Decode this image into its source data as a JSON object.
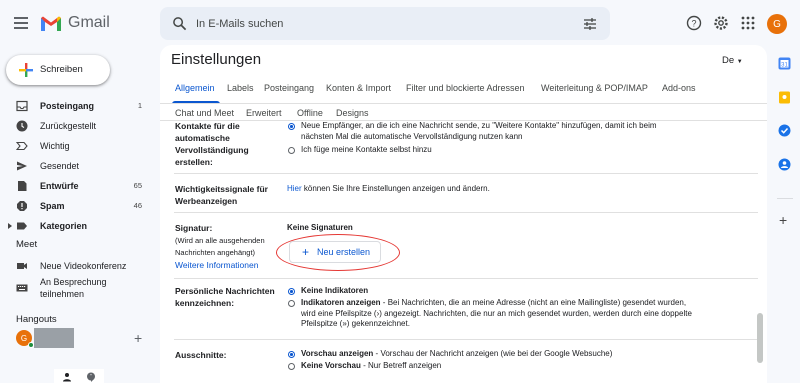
{
  "app": {
    "name": "Gmail"
  },
  "search": {
    "placeholder": "In E-Mails suchen"
  },
  "header": {
    "avatar_letter": "G"
  },
  "compose": {
    "label": "Schreiben"
  },
  "nav": {
    "items": [
      {
        "label": "Posteingang",
        "count": "1",
        "icon": "inbox-icon"
      },
      {
        "label": "Zurückgestellt",
        "count": "",
        "icon": "clock-icon"
      },
      {
        "label": "Wichtig",
        "count": "",
        "icon": "label-important-icon"
      },
      {
        "label": "Gesendet",
        "count": "",
        "icon": "send-icon"
      },
      {
        "label": "Entwürfe",
        "count": "65",
        "icon": "draft-icon"
      },
      {
        "label": "Spam",
        "count": "46",
        "icon": "spam-icon"
      },
      {
        "label": "Kategorien",
        "count": "",
        "icon": "label-icon"
      }
    ]
  },
  "meet": {
    "title": "Meet",
    "new_meeting": "Neue Videokonferenz",
    "join_line1": "An Besprechung",
    "join_line2": "teilnehmen"
  },
  "hangouts": {
    "title": "Hangouts",
    "avatar_letter": "G"
  },
  "settings": {
    "title": "Einstellungen",
    "lang": "De",
    "tabs": [
      "Allgemein",
      "Labels",
      "Posteingang",
      "Konten & Import",
      "Filter und blockierte Adressen",
      "Weiterleitung & POP/IMAP",
      "Add-ons",
      "Chat und Meet",
      "Erweitert",
      "Offline",
      "Designs"
    ]
  },
  "autocomplete": {
    "label1": "Kontakte für die",
    "label2": "automatische",
    "label3": "Vervollständigung",
    "label4": "erstellen:",
    "opt1_line1": "Neue Empfänger, an die ich eine Nachricht sende, zu \"Weitere Kontakte\" hinzufügen, damit ich beim",
    "opt1_line2": "nächsten Mal die automatische Vervollständigung nutzen kann",
    "opt2": "Ich füge meine Kontakte selbst hinzu"
  },
  "ads": {
    "label1": "Wichtigkeitssignale für",
    "label2": "Werbeanzeigen",
    "link": "Hier",
    "text": " können Sie Ihre Einstellungen anzeigen und ändern."
  },
  "signature": {
    "label": "Signatur:",
    "sub1": "(Wird an alle ausgehenden",
    "sub2": "Nachrichten angehängt)",
    "more_info": "Weitere Informationen",
    "none": "Keine Signaturen",
    "new_button": "Neu erstellen"
  },
  "personal": {
    "label1": "Persönliche Nachrichten",
    "label2": "kennzeichnen:",
    "opt1": "Keine Indikatoren",
    "opt2_bold": "Indikatoren anzeigen",
    "opt2_line1": " - Bei Nachrichten, die an meine Adresse (nicht an eine Mailingliste) gesendet wurden,",
    "opt2_line2": "wird eine Pfeilspitze (›) angezeigt. Nachrichten, die nur an mich gesendet wurden, werden durch eine doppelte",
    "opt2_line3": "Pfeilspitze (») gekennzeichnet."
  },
  "snippets": {
    "label": "Ausschnitte:",
    "opt1_bold": "Vorschau anzeigen",
    "opt1_text": " - Vorschau der Nachricht anzeigen (wie bei der Google Websuche)",
    "opt2_bold": "Keine Vorschau",
    "opt2_text": " - Nur Betreff anzeigen"
  },
  "colors": {
    "accent": "#0b57d0",
    "highlight_ring": "#e53935",
    "avatar": "#e8710a"
  }
}
